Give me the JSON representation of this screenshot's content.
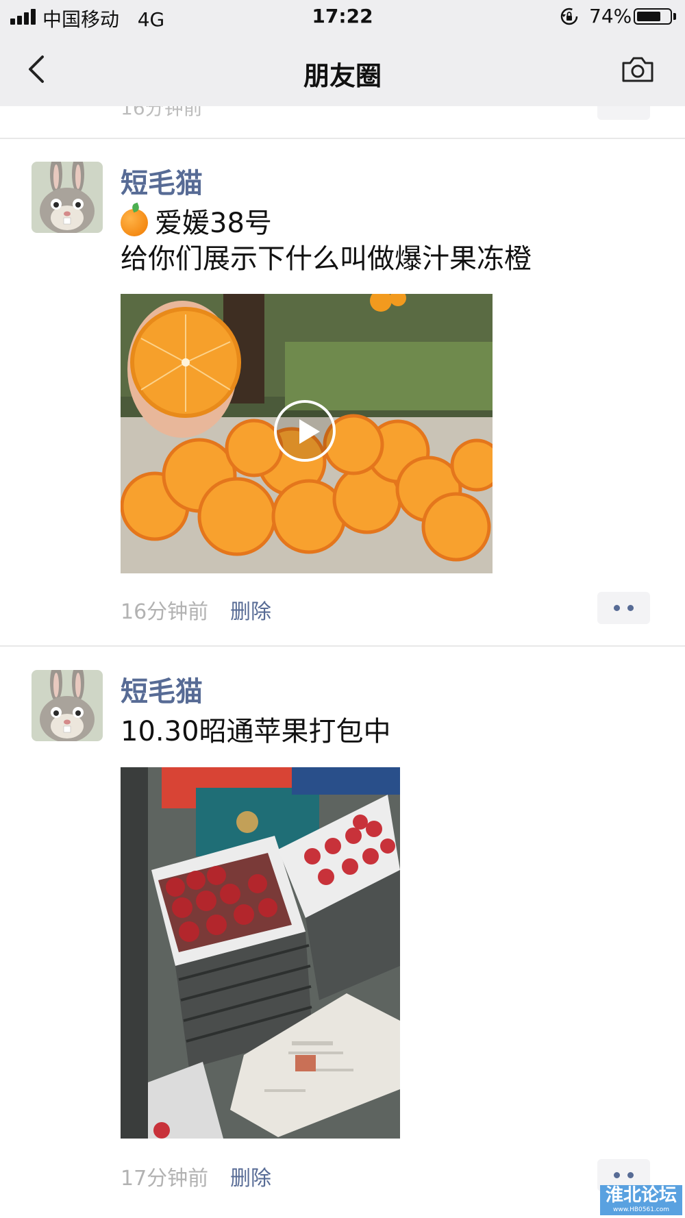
{
  "status_bar": {
    "carrier": "中国移动",
    "network": "4G",
    "time": "17:22",
    "battery_percent": "74%",
    "battery_level": 0.74
  },
  "nav": {
    "title": "朋友圈",
    "back_icon": "chevron-left-icon",
    "camera_icon": "camera-icon"
  },
  "previous_post": {
    "time": "16分钟前"
  },
  "posts": [
    {
      "author": "短毛猫",
      "lines": [
        "爱媛38号",
        "给你们展示下什么叫做爆汁果冻橙"
      ],
      "media_type": "video",
      "time": "16分钟前",
      "delete_label": "删除"
    },
    {
      "author": "短毛猫",
      "lines": [
        "10.30昭通苹果打包中"
      ],
      "media_type": "image",
      "time": "17分钟前",
      "delete_label": "删除"
    }
  ],
  "watermark": {
    "title": "淮北论坛",
    "url": "www.HB0561.com"
  },
  "colors": {
    "link": "#576b95",
    "meta": "#b2b2b2",
    "nav_bg": "#eeeef0"
  }
}
